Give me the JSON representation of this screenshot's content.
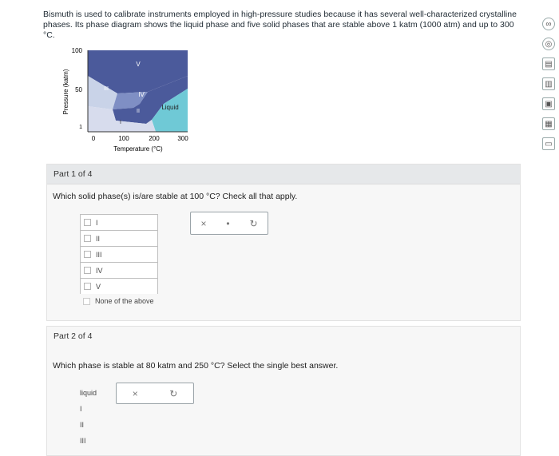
{
  "intro": {
    "text": "Bismuth is used to calibrate instruments employed in high-pressure studies because it has several well-characterized crystalline phases. Its phase diagram shows the liquid phase and five solid phases that are stable above 1 katm (1000 atm) and up to 300 °C."
  },
  "sidebar": {
    "icons": [
      "infinity-icon",
      "eye-icon",
      "document-icon",
      "chart-icon",
      "image-icon",
      "grid-icon",
      "message-icon"
    ],
    "glyphs": [
      "∞",
      "◎",
      "▤",
      "▥",
      "▣",
      "▦",
      "▭"
    ]
  },
  "chart_data": {
    "type": "area",
    "xlabel": "Temperature (°C)",
    "ylabel": "Pressure (katm)",
    "x_ticks": [
      "0",
      "100",
      "200",
      "300"
    ],
    "y_ticks": [
      "1",
      "50",
      "100"
    ],
    "xlim": [
      0,
      300
    ],
    "ylim": [
      0,
      100
    ],
    "region_labels": [
      "V",
      "IV",
      "III",
      "II",
      "I",
      "Liquid"
    ],
    "colors": {
      "light": "#c9d3e8",
      "mid": "#7f8fc4",
      "dark": "#4b5a9b",
      "liquid": "#6fc9d6"
    }
  },
  "part1": {
    "header": "Part 1 of 4",
    "question": "Which solid phase(s) is/are stable at 100 °C? Check all that apply.",
    "options": [
      "I",
      "II",
      "III",
      "IV",
      "V",
      "None of the above"
    ],
    "tool_x": "×",
    "tool_dot": "•",
    "tool_refresh": "↻"
  },
  "part2": {
    "header": "Part 2 of 4",
    "question": "Which phase is stable at 80 katm and 250 °C? Select the single best answer.",
    "options": [
      "liquid",
      "I",
      "II",
      "III"
    ],
    "tool_x": "×",
    "tool_refresh": "↻"
  }
}
